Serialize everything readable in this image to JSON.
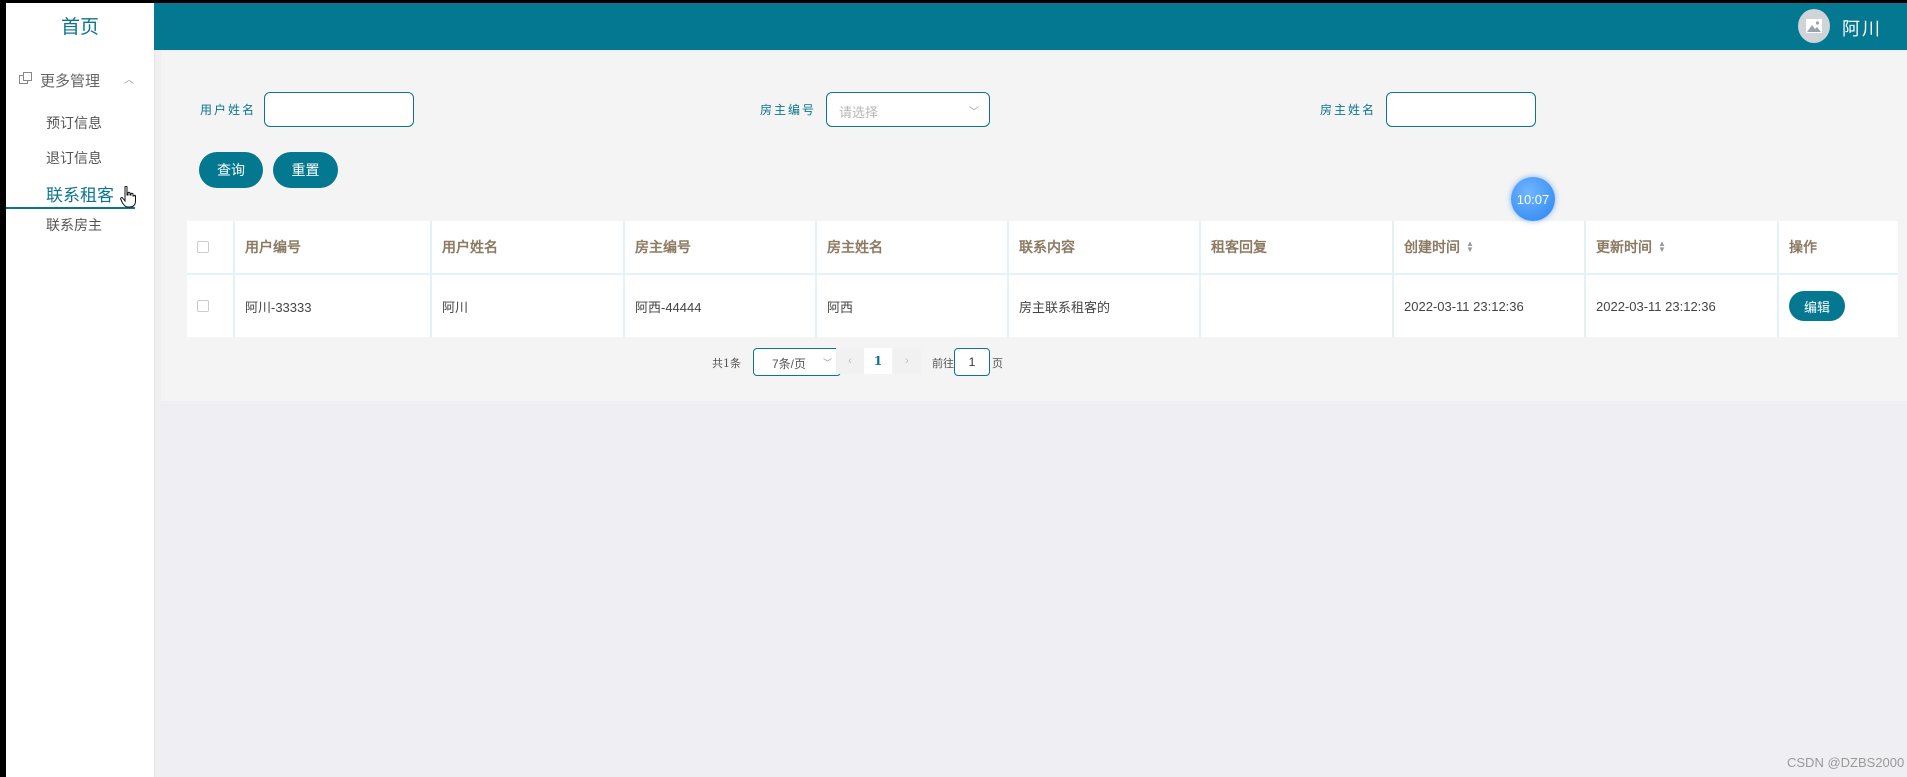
{
  "sidebar": {
    "home_label": "首页",
    "group_label": "更多管理",
    "items": [
      {
        "label": "预订信息",
        "active": false
      },
      {
        "label": "退订信息",
        "active": false
      },
      {
        "label": "联系租客",
        "active": true
      },
      {
        "label": "联系房主",
        "active": false
      }
    ]
  },
  "header": {
    "username": "阿川"
  },
  "search": {
    "user_name_label": "用户姓名",
    "user_name_value": "",
    "owner_id_label": "房主编号",
    "owner_id_placeholder": "请选择",
    "owner_name_label": "房主姓名",
    "owner_name_value": "",
    "query_button": "查询",
    "reset_button": "重置"
  },
  "table": {
    "columns": [
      "用户编号",
      "用户姓名",
      "房主编号",
      "房主姓名",
      "联系内容",
      "租客回复",
      "创建时间",
      "更新时间",
      "操作"
    ],
    "rows": [
      {
        "user_id": "阿川-33333",
        "user_name": "阿川",
        "owner_id": "阿西-44444",
        "owner_name": "阿西",
        "content": "房主联系租客的",
        "reply": "",
        "created": "2022-03-11 23:12:36",
        "updated": "2022-03-11 23:12:36",
        "action": "编辑"
      }
    ]
  },
  "pagination": {
    "total_text": "共1条",
    "page_size": "7条/页",
    "current_page": "1",
    "goto_prefix": "前往",
    "goto_value": "1",
    "goto_suffix": "页"
  },
  "clock": "10:07",
  "watermark": "CSDN @DZBS2000",
  "colors": {
    "primary": "#047791",
    "header_text": "#ffffff",
    "column_header": "#8c7a63"
  }
}
